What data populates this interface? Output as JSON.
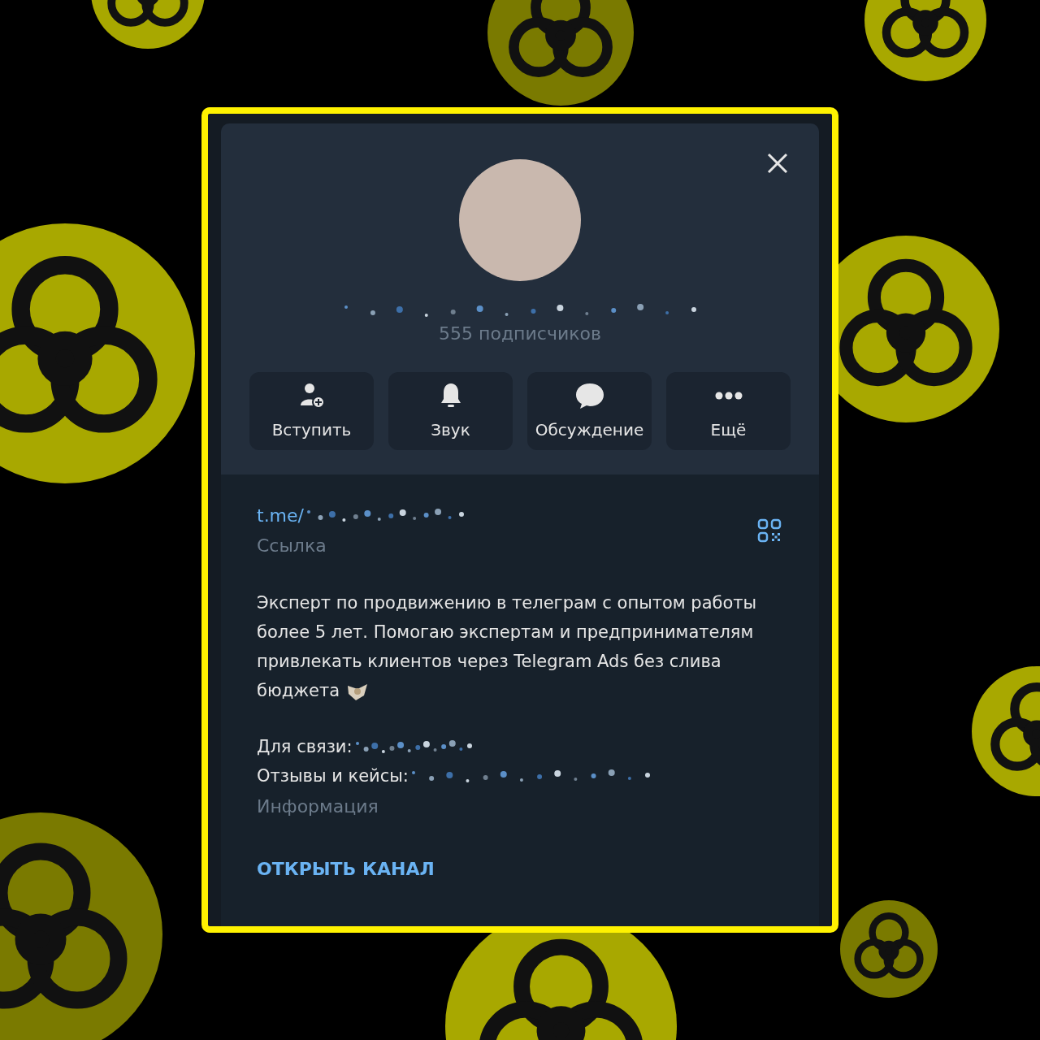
{
  "channel": {
    "subscribers": "555 подписчиков"
  },
  "actions": [
    {
      "kind": "join",
      "label": "Вступить"
    },
    {
      "kind": "sound",
      "label": "Звук"
    },
    {
      "kind": "discussion",
      "label": "Обсуждение"
    },
    {
      "kind": "more",
      "label": "Ещё"
    }
  ],
  "link": {
    "value": "t.me/",
    "caption": "Ссылка"
  },
  "info": {
    "description": "Эксперт по продвижению в телеграм с опытом работы более 5 лет. Помогаю экспертам и предпринимателям привлекать клиентов через Telegram Ads без слива бюджета",
    "contacts": [
      "Для связи:",
      "Отзывы и кейсы:"
    ],
    "caption": "Информация"
  },
  "open_button": "ОТКРЫТЬ КАНАЛ"
}
